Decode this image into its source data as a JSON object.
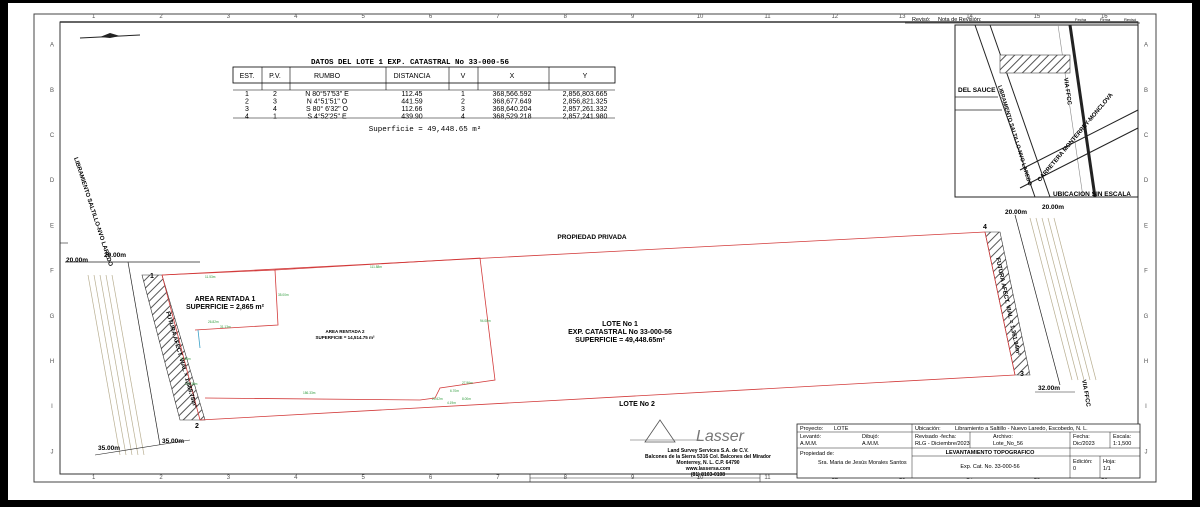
{
  "grid": {
    "columns": [
      "1",
      "2",
      "3",
      "4",
      "5",
      "6",
      "7",
      "8",
      "9",
      "10",
      "11",
      "12",
      "13",
      "14",
      "15",
      "16"
    ],
    "rows": [
      "A",
      "B",
      "C",
      "D",
      "E",
      "F",
      "G",
      "H",
      "I",
      "J"
    ]
  },
  "header": {
    "reviso": "Revisó:",
    "nota": "Nota de Revisión:",
    "fecha": "Fecha",
    "firma": "Firma",
    "revisa": "Revisó"
  },
  "table": {
    "title": "DATOS DEL LOTE 1 EXP. CATASTRAL No 33-000-56",
    "headers": [
      "EST.",
      "P.V.",
      "RUMBO",
      "DISTANCIA",
      "V",
      "X",
      "Y"
    ],
    "rows": [
      [
        "1",
        "2",
        "N 80°57'53\" E",
        "112.45",
        "1",
        "368,566.592",
        "2,856,803.665"
      ],
      [
        "2",
        "3",
        "N  4°51'51\" O",
        "441.59",
        "2",
        "368,677.649",
        "2,856,821.325"
      ],
      [
        "3",
        "4",
        "S 80° 6'32\" O",
        "112.66",
        "3",
        "368,640.204",
        "2,857,261.332"
      ],
      [
        "4",
        "1",
        "S  4°52'25\" E",
        "439.90",
        "4",
        "368,529.218",
        "2,857,241.980"
      ]
    ],
    "superficie": "Superficie = 49,448.65 m²"
  },
  "location_map": {
    "del_sauce": "DEL SAUCE",
    "libramiento": "LIBRAMIENTO SALTILLO-NVO LAREDO",
    "via": "VIA FFCC",
    "carretera": "CARRETERA MONTERREY-MONCLOVA",
    "caption": "UBICACION SIN ESCALA"
  },
  "plan": {
    "propiedad_privada": "PROPIEDAD PRIVADA",
    "lote1": {
      "line1": "LOTE No 1",
      "line2": "EXP. CATASTRAL No 33-000-56",
      "line3": "SUPERFICIE = 49,448.65m²"
    },
    "lote2": "LOTE No 2",
    "area1": {
      "line1": "AREA RENTADA 1",
      "line2": "SUPERFICIE = 2,865 m²"
    },
    "area2": {
      "line1": "AREA RENTADA 2",
      "line2": "SUPERFICIE = 14,514.75 m²"
    },
    "left_road": "LIBRAMIENTO SALTILLO-NVO LAREDO",
    "left_future": "FUTURA AFECT. VIAL = 1,588.78m²",
    "right_future": "FUTURA AFECT. VIAL = 1,361.94m²",
    "via_ffcc": "VIA FFCC",
    "dims": {
      "d20a": "20.00m",
      "d20b": "20.00m",
      "d20c": "20.00m",
      "d20d": "20.00m",
      "d35a": "35.00m",
      "d35b": "35.00m",
      "d32": "32.00m"
    },
    "vertices": {
      "v1": "1",
      "v2": "2",
      "v3": "3",
      "v4": "4"
    },
    "small": [
      "111.88m",
      "11.53m",
      "35.00m",
      "26.82m",
      "31.13m",
      "29.38m",
      "94.08m",
      "129.38m",
      "186.33m",
      "27.96m",
      "6.70m",
      "20.62m",
      "4.19m",
      "8.00m"
    ]
  },
  "company": {
    "logo": "Lasser",
    "name": "Land Survey Services S.A. de C.V.",
    "address1": "Balcones de la Sierra 5316 Col. Balcones del Mirador",
    "address2": "Monterrey, N. L. C.P. 64790",
    "web": "www.lassersa.com",
    "phone": "(81) 8103-0108"
  },
  "title_block": {
    "proyecto_label": "Proyecto:",
    "proyecto": "LOTE",
    "ubicacion_label": "Ubicación:",
    "ubicacion": "Libramiento a Saltillo - Nuevo Laredo, Escobedo, N. L.",
    "levanto_label": "Levantó:",
    "levanto": "A.M.M.",
    "dibujo_label": "Dibujó:",
    "dibujo": "A.M.M.",
    "revisado_label": "Revisado -fecha:",
    "revisado": "RLG - Diciembre/2023",
    "archivo_label": "Archivo:",
    "archivo": "Lote_No_56",
    "fecha_label": "Fecha:",
    "fecha": "Dic/2023",
    "escala_label": "Escala:",
    "escala": "1:1,500",
    "propiedad_label": "Propiedad de:",
    "propietario": "Sra. Maria de Jesús Morales Santos",
    "levantamiento": "LEVANTAMIENTO TOPOGRAFICO",
    "exp": "Exp. Cat. No. 33-000-56",
    "edicion_label": "Edición:",
    "edicion": "0",
    "hoja_label": "Hoja:",
    "hoja": "1/1"
  },
  "colors": {
    "boundary": "#d23a3a",
    "dims": "#2e9a3a",
    "hatch": "#444444",
    "road": "#b8ae90",
    "accent": "#3aa0c8"
  }
}
